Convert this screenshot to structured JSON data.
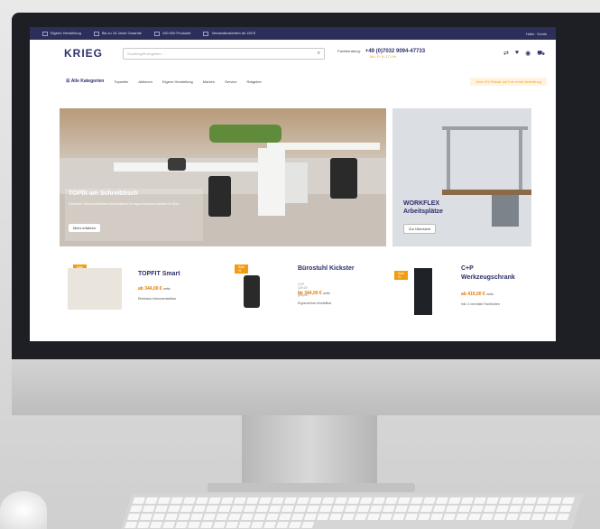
{
  "shop": {
    "usps": [
      "Eigene Herstellung",
      "Bis zu 15 Jahre Garantie",
      "100.000 Produkte",
      "Versandkostenfrei ab 150 €"
    ],
    "account": "Hallo · Konto",
    "logo": "KRIEG",
    "search_placeholder": "Suchbegriff eingeben ...",
    "phone_label": "Fachberatung:",
    "phone": "+49 (0)7032 9094-47733",
    "phone_sub": "Mo–Fr 8–17 Uhr",
    "all_categories": "Alle Kategorien",
    "nav": [
      "Topseller",
      "Aktionen",
      "Eigene Herstellung",
      "Marken",
      "Service",
      "Ratgeber"
    ],
    "promo": "Jetzt 5% Rabatt auf Ihre erste Bestellung",
    "hero1": {
      "title": "TOPfit am Schreibtisch",
      "subtitle": "Elektrisch höhenverstellbare Schreibtische für ergonomisches Arbeiten im Büro",
      "button": "Mehr erfahren"
    },
    "hero2": {
      "title": "WORKFLEX\nArbeitsplätze",
      "button": "Zur Übersicht"
    },
    "products": [
      {
        "badge": "Sale %",
        "name": "TOPFIT Smart",
        "old_price": "",
        "price": "ab 344,00 €",
        "price_note": "netto",
        "note": "Elektrisch höhenverstellbar"
      },
      {
        "badge": "Sale %",
        "name": "Bürostuhl Kickster",
        "old_price": "UVP 429,00 € gespart",
        "price": "ab 344,00 €",
        "price_note": "netto",
        "note": "Ergonomisch einstellbar"
      },
      {
        "badge": "Sale %",
        "name": "C+P\nWerkzeugschrank",
        "old_price": "",
        "price": "ab 419,00 €",
        "price_note": "netto",
        "note": "Inkl. 4 verzinkte Fachböden"
      }
    ]
  }
}
